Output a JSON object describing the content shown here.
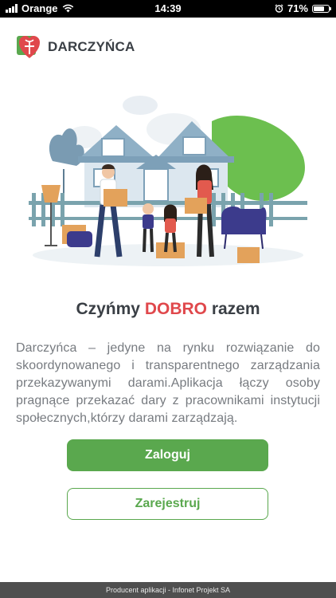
{
  "status_bar": {
    "carrier": "Orange",
    "time": "14:39",
    "battery_percent": "71%",
    "battery_level": 0.71,
    "icons": [
      "signal-icon",
      "wifi-icon",
      "alarm-icon",
      "battery-icon"
    ]
  },
  "app": {
    "name": "DARCZYŃCA",
    "logo_icon": "heart-gift-logo",
    "colors": {
      "brand_green": "#5aa84e",
      "accent_red": "#e0484c",
      "text_dark": "#3a3f45",
      "text_muted": "#777b80"
    }
  },
  "headline": {
    "before": "Czyńmy ",
    "accent": "DOBRO",
    "after": " razem"
  },
  "description": "Darczyńca – jedyne na rynku rozwiązanie do skoordynowanego i transparentnego zarządzania przekazywanymi darami.Aplikacja łączy osoby pragnące przekazać dary z pracownikami instytucji społecznych,którzy darami zarządzają.",
  "buttons": {
    "login": "Zaloguj",
    "register": "Zarejestruj"
  },
  "footer": "Producent aplikacji - Infonet Projekt SA"
}
